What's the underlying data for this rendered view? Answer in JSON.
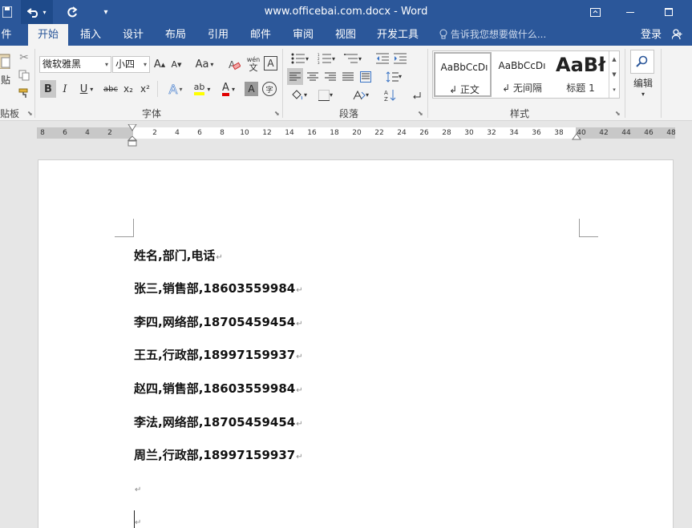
{
  "titlebar": {
    "title": "www.officebai.com.docx - Word",
    "icons": {
      "save": "save-icon",
      "undo": "undo-icon",
      "redo": "redo-icon",
      "qat": "customize-qat-icon"
    }
  },
  "tabs": [
    "件",
    "开始",
    "插入",
    "设计",
    "布局",
    "引用",
    "邮件",
    "审阅",
    "视图",
    "开发工具"
  ],
  "tell_me": "告诉我您想要做什么...",
  "account": {
    "login": "登录",
    "share": "共"
  },
  "ribbon": {
    "clipboard": {
      "paste": "贴",
      "label": "贴板"
    },
    "font": {
      "name": "微软雅黑",
      "size": "小四",
      "grow": "A",
      "shrink": "A",
      "case": "Aa",
      "phonetic_top": "wén",
      "phonetic_bottom": "文",
      "border_char": "A",
      "bold": "B",
      "italic": "I",
      "underline": "U",
      "strike": "abc",
      "sub": "x₂",
      "sup": "x²",
      "effects": "A",
      "highlight": "ab",
      "color": "A",
      "shading": "A",
      "enclose": "字",
      "label": "字体"
    },
    "paragraph": {
      "label": "段落"
    },
    "styles": {
      "label": "样式",
      "items": [
        {
          "preview": "AaBbCcDı",
          "name": "↲ 正文"
        },
        {
          "preview": "AaBbCcDı",
          "name": "↲ 无间隔"
        },
        {
          "preview": "AaBł",
          "name": "标题 1"
        }
      ]
    },
    "editing": {
      "label": "编辑"
    }
  },
  "ruler": {
    "ticks": [
      "8",
      "6",
      "4",
      "2",
      "",
      "2",
      "4",
      "6",
      "8",
      "10",
      "12",
      "14",
      "16",
      "18",
      "20",
      "22",
      "24",
      "26",
      "28",
      "30",
      "32",
      "34",
      "36",
      "38",
      "40",
      "42",
      "44",
      "46",
      "48"
    ]
  },
  "document": {
    "paragraphs": [
      "姓名,部门,电话",
      "张三,销售部,18603559984",
      "李四,网络部,18705459454",
      "王五,行政部,18997159937",
      "赵四,销售部,18603559984",
      "李法,网络部,18705459454",
      "周兰,行政部,18997159937",
      "",
      ""
    ],
    "paragraph_mark": "↵"
  }
}
